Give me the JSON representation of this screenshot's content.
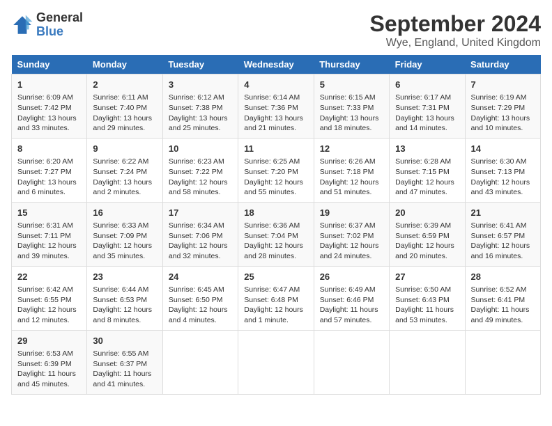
{
  "header": {
    "logo_line1": "General",
    "logo_line2": "Blue",
    "title": "September 2024",
    "subtitle": "Wye, England, United Kingdom"
  },
  "days_of_week": [
    "Sunday",
    "Monday",
    "Tuesday",
    "Wednesday",
    "Thursday",
    "Friday",
    "Saturday"
  ],
  "weeks": [
    [
      {
        "day": "1",
        "lines": [
          "Sunrise: 6:09 AM",
          "Sunset: 7:42 PM",
          "Daylight: 13 hours",
          "and 33 minutes."
        ]
      },
      {
        "day": "2",
        "lines": [
          "Sunrise: 6:11 AM",
          "Sunset: 7:40 PM",
          "Daylight: 13 hours",
          "and 29 minutes."
        ]
      },
      {
        "day": "3",
        "lines": [
          "Sunrise: 6:12 AM",
          "Sunset: 7:38 PM",
          "Daylight: 13 hours",
          "and 25 minutes."
        ]
      },
      {
        "day": "4",
        "lines": [
          "Sunrise: 6:14 AM",
          "Sunset: 7:36 PM",
          "Daylight: 13 hours",
          "and 21 minutes."
        ]
      },
      {
        "day": "5",
        "lines": [
          "Sunrise: 6:15 AM",
          "Sunset: 7:33 PM",
          "Daylight: 13 hours",
          "and 18 minutes."
        ]
      },
      {
        "day": "6",
        "lines": [
          "Sunrise: 6:17 AM",
          "Sunset: 7:31 PM",
          "Daylight: 13 hours",
          "and 14 minutes."
        ]
      },
      {
        "day": "7",
        "lines": [
          "Sunrise: 6:19 AM",
          "Sunset: 7:29 PM",
          "Daylight: 13 hours",
          "and 10 minutes."
        ]
      }
    ],
    [
      {
        "day": "8",
        "lines": [
          "Sunrise: 6:20 AM",
          "Sunset: 7:27 PM",
          "Daylight: 13 hours",
          "and 6 minutes."
        ]
      },
      {
        "day": "9",
        "lines": [
          "Sunrise: 6:22 AM",
          "Sunset: 7:24 PM",
          "Daylight: 13 hours",
          "and 2 minutes."
        ]
      },
      {
        "day": "10",
        "lines": [
          "Sunrise: 6:23 AM",
          "Sunset: 7:22 PM",
          "Daylight: 12 hours",
          "and 58 minutes."
        ]
      },
      {
        "day": "11",
        "lines": [
          "Sunrise: 6:25 AM",
          "Sunset: 7:20 PM",
          "Daylight: 12 hours",
          "and 55 minutes."
        ]
      },
      {
        "day": "12",
        "lines": [
          "Sunrise: 6:26 AM",
          "Sunset: 7:18 PM",
          "Daylight: 12 hours",
          "and 51 minutes."
        ]
      },
      {
        "day": "13",
        "lines": [
          "Sunrise: 6:28 AM",
          "Sunset: 7:15 PM",
          "Daylight: 12 hours",
          "and 47 minutes."
        ]
      },
      {
        "day": "14",
        "lines": [
          "Sunrise: 6:30 AM",
          "Sunset: 7:13 PM",
          "Daylight: 12 hours",
          "and 43 minutes."
        ]
      }
    ],
    [
      {
        "day": "15",
        "lines": [
          "Sunrise: 6:31 AM",
          "Sunset: 7:11 PM",
          "Daylight: 12 hours",
          "and 39 minutes."
        ]
      },
      {
        "day": "16",
        "lines": [
          "Sunrise: 6:33 AM",
          "Sunset: 7:09 PM",
          "Daylight: 12 hours",
          "and 35 minutes."
        ]
      },
      {
        "day": "17",
        "lines": [
          "Sunrise: 6:34 AM",
          "Sunset: 7:06 PM",
          "Daylight: 12 hours",
          "and 32 minutes."
        ]
      },
      {
        "day": "18",
        "lines": [
          "Sunrise: 6:36 AM",
          "Sunset: 7:04 PM",
          "Daylight: 12 hours",
          "and 28 minutes."
        ]
      },
      {
        "day": "19",
        "lines": [
          "Sunrise: 6:37 AM",
          "Sunset: 7:02 PM",
          "Daylight: 12 hours",
          "and 24 minutes."
        ]
      },
      {
        "day": "20",
        "lines": [
          "Sunrise: 6:39 AM",
          "Sunset: 6:59 PM",
          "Daylight: 12 hours",
          "and 20 minutes."
        ]
      },
      {
        "day": "21",
        "lines": [
          "Sunrise: 6:41 AM",
          "Sunset: 6:57 PM",
          "Daylight: 12 hours",
          "and 16 minutes."
        ]
      }
    ],
    [
      {
        "day": "22",
        "lines": [
          "Sunrise: 6:42 AM",
          "Sunset: 6:55 PM",
          "Daylight: 12 hours",
          "and 12 minutes."
        ]
      },
      {
        "day": "23",
        "lines": [
          "Sunrise: 6:44 AM",
          "Sunset: 6:53 PM",
          "Daylight: 12 hours",
          "and 8 minutes."
        ]
      },
      {
        "day": "24",
        "lines": [
          "Sunrise: 6:45 AM",
          "Sunset: 6:50 PM",
          "Daylight: 12 hours",
          "and 4 minutes."
        ]
      },
      {
        "day": "25",
        "lines": [
          "Sunrise: 6:47 AM",
          "Sunset: 6:48 PM",
          "Daylight: 12 hours",
          "and 1 minute."
        ]
      },
      {
        "day": "26",
        "lines": [
          "Sunrise: 6:49 AM",
          "Sunset: 6:46 PM",
          "Daylight: 11 hours",
          "and 57 minutes."
        ]
      },
      {
        "day": "27",
        "lines": [
          "Sunrise: 6:50 AM",
          "Sunset: 6:43 PM",
          "Daylight: 11 hours",
          "and 53 minutes."
        ]
      },
      {
        "day": "28",
        "lines": [
          "Sunrise: 6:52 AM",
          "Sunset: 6:41 PM",
          "Daylight: 11 hours",
          "and 49 minutes."
        ]
      }
    ],
    [
      {
        "day": "29",
        "lines": [
          "Sunrise: 6:53 AM",
          "Sunset: 6:39 PM",
          "Daylight: 11 hours",
          "and 45 minutes."
        ]
      },
      {
        "day": "30",
        "lines": [
          "Sunrise: 6:55 AM",
          "Sunset: 6:37 PM",
          "Daylight: 11 hours",
          "and 41 minutes."
        ]
      },
      null,
      null,
      null,
      null,
      null
    ]
  ]
}
